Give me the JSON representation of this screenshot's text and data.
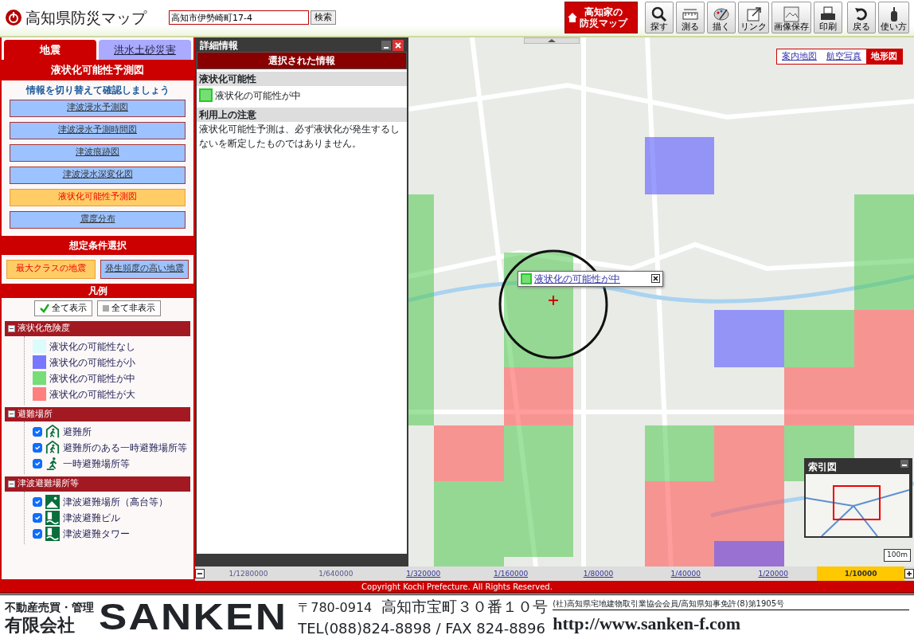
{
  "header": {
    "title": "高知県防災マップ",
    "search": {
      "value": "高知市伊勢崎町17-4"
    },
    "search_button": "検索",
    "home_button": [
      "高知家の",
      "防災マップ"
    ],
    "tools": [
      {
        "label": "探す",
        "kind": "search"
      },
      {
        "label": "測る",
        "kind": "ruler"
      },
      {
        "label": "描く",
        "kind": "palette"
      },
      {
        "label": "リンク",
        "kind": "link"
      },
      {
        "label": "画像保存",
        "kind": "save"
      },
      {
        "label": "印刷",
        "kind": "print"
      },
      {
        "label": "戻る",
        "kind": "back"
      },
      {
        "label": "使い方",
        "kind": "help"
      }
    ]
  },
  "sidebar": {
    "tabs": [
      {
        "label": "地震",
        "selected": true
      },
      {
        "label": "洪水土砂災害",
        "selected": false
      }
    ],
    "title": "液状化可能性予測図",
    "hint": "情報を切り替えて確認しましょう",
    "map_types": [
      {
        "label": "津波浸水予測図",
        "selected": false
      },
      {
        "label": "津波浸水予測時間図",
        "selected": false
      },
      {
        "label": "津波痕跡図",
        "selected": false
      },
      {
        "label": "津波浸水深変化図",
        "selected": false
      },
      {
        "label": "液状化可能性予測図",
        "selected": true
      },
      {
        "label": "震度分布",
        "selected": false
      }
    ],
    "condition_title": "想定条件選択",
    "conditions": [
      {
        "label": "最大クラスの地震",
        "selected": true
      },
      {
        "label": "発生頻度の高い地震",
        "selected": false
      }
    ],
    "legend_title": "凡例",
    "legend_buttons": [
      {
        "label": "全て表示",
        "kind": "check"
      },
      {
        "label": "全て非表示",
        "kind": "square"
      }
    ],
    "legend_groups": [
      {
        "label": "液状化危険度",
        "expanded": true,
        "swatches": [
          {
            "label": "液状化の可能性なし",
            "color": "#dcfbfb"
          },
          {
            "label": "液状化の可能性が小",
            "color": "#7777ff"
          },
          {
            "label": "液状化の可能性が中",
            "color": "#77dd77"
          },
          {
            "label": "液状化の可能性が大",
            "color": "#ff7f7f"
          }
        ]
      },
      {
        "label": "避難場所",
        "expanded": true,
        "items": [
          {
            "label": "避難所",
            "checked": true,
            "kind": "shelter"
          },
          {
            "label": "避難所のある一時避難場所等",
            "checked": true,
            "kind": "shelter"
          },
          {
            "label": "一時避難場所等",
            "checked": true,
            "kind": "runner"
          }
        ]
      },
      {
        "label": "津波避難場所等",
        "expanded": true,
        "items": [
          {
            "label": "津波避難場所（高台等）",
            "checked": true,
            "kind": "hill"
          },
          {
            "label": "津波避難ビル",
            "checked": true,
            "kind": "building"
          },
          {
            "label": "津波避難タワー",
            "checked": true,
            "kind": "building"
          }
        ]
      }
    ]
  },
  "details": {
    "title": "詳細情報",
    "header": "選択された情報",
    "sections": [
      {
        "heading": "液状化可能性",
        "kind": "swatch",
        "text": "液状化の可能性が中"
      },
      {
        "heading": "利用上の注意",
        "kind": "text",
        "text": "液状化可能性予測は、必ず液状化が発生するしないを断定したものではありません。"
      }
    ]
  },
  "map": {
    "layers": [
      {
        "label": "案内地図",
        "selected": false
      },
      {
        "label": "航空写真",
        "selected": false
      },
      {
        "label": "地形図",
        "selected": true
      }
    ],
    "popup": "液状化の可能性が中",
    "overview_title": "索引図",
    "scale_label": "100m"
  },
  "scales": [
    {
      "label": "1/1280000",
      "disabled": true,
      "selected": false
    },
    {
      "label": "1/640000",
      "disabled": true,
      "selected": false
    },
    {
      "label": "1/320000",
      "disabled": false,
      "selected": false
    },
    {
      "label": "1/160000",
      "disabled": false,
      "selected": false
    },
    {
      "label": "1/80000",
      "disabled": false,
      "selected": false
    },
    {
      "label": "1/40000",
      "disabled": false,
      "selected": false
    },
    {
      "label": "1/20000",
      "disabled": false,
      "selected": false
    },
    {
      "label": "1/10000",
      "disabled": false,
      "selected": true
    }
  ],
  "copyright": "Copyright Kochi Prefecture. All Rights Reserved.",
  "ad": {
    "tagline": "不動産売買・管理",
    "company": "有限会社",
    "brand": "SANKEN",
    "postal": "〒780-0914",
    "address": "高知市宝町３０番１０号",
    "tel": "TEL(088)824-8898 / FAX 824-8896",
    "license": "(社)高知県宅地建物取引業協会会員/高知県知事免許(8)第1905号",
    "url": "http://www.sanken-f.com"
  }
}
